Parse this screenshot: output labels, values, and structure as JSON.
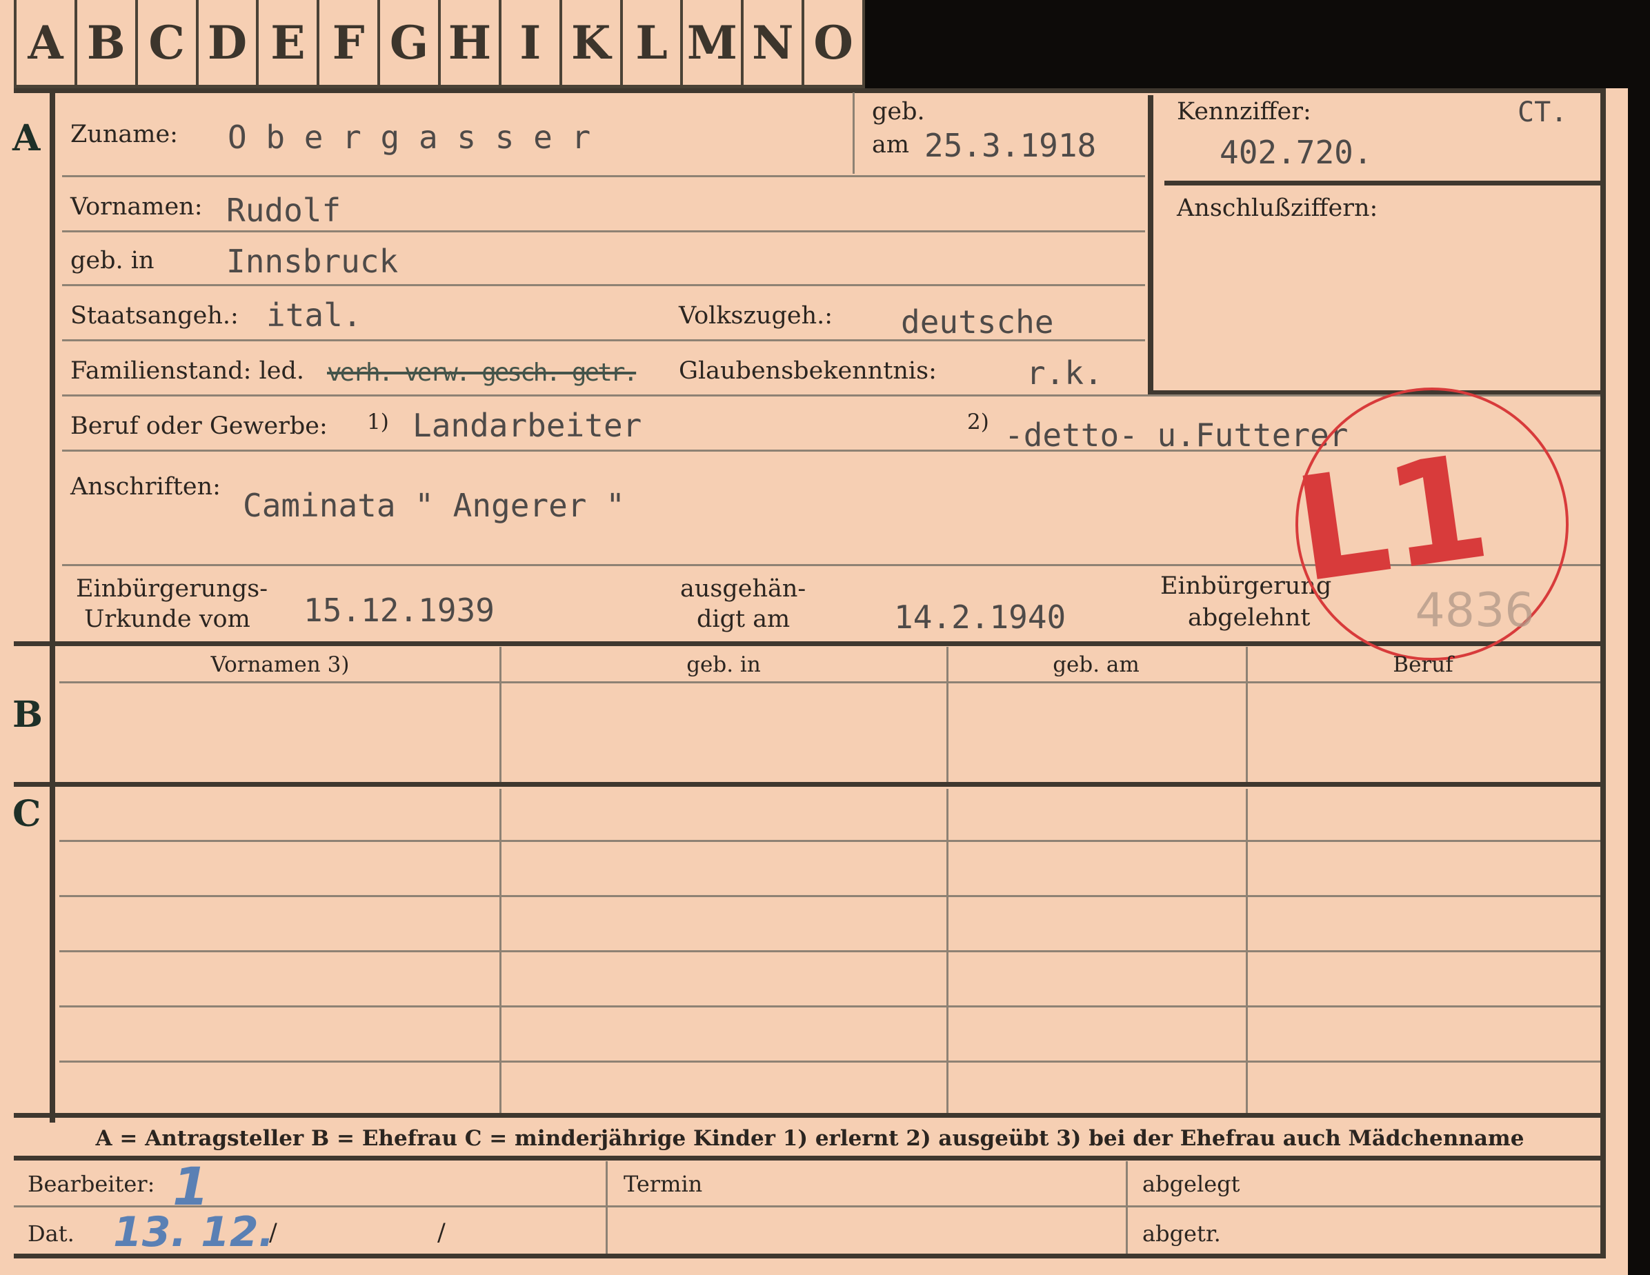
{
  "tabs": [
    "A",
    "B",
    "C",
    "D",
    "E",
    "F",
    "G",
    "H",
    "I",
    "K",
    "L",
    "M",
    "N",
    "O"
  ],
  "sections": {
    "a": "A",
    "b": "B",
    "c": "C"
  },
  "labels": {
    "zuname": "Zuname:",
    "geb_top": "geb.",
    "geb_am": "am",
    "kennziffer": "Kennziffer:",
    "anschluss": "Anschlußziffern:",
    "vornamen": "Vornamen:",
    "geb_in": "geb. in",
    "staatsangeh": "Staatsangeh.:",
    "volkszugeh": "Volkszugeh.:",
    "familienstand": "Familienstand: led.",
    "familien_strike": "verh. verw. gesch. getr.",
    "glaubens": "Glaubensbekenntnis:",
    "beruf": "Beruf oder Gewerbe:",
    "beruf_note1": "1)",
    "beruf_note2": "2)",
    "anschriften": "Anschriften:",
    "einb_1": "Einbürgerungs-",
    "einb_2": "Urkunde vom",
    "ausg_1": "ausgehän-",
    "ausg_2": "digt am",
    "abgel_1": "Einbürgerung",
    "abgel_2": "abgelehnt"
  },
  "values": {
    "zuname": "O b e r g a s s e r",
    "geb_am": "25.3.1918",
    "kennziffer_suffix": "CT.",
    "kennziffer": "402.720.",
    "vornamen": "Rudolf",
    "geb_in": "Innsbruck",
    "staatsangeh": "ital.",
    "volkszugeh": "deutsche",
    "glaubens": "r.k.",
    "beruf1": "Landarbeiter",
    "beruf2": "-detto- u.Futterer",
    "anschriften": "Caminata \" Angerer \"",
    "einb_vom": "15.12.1939",
    "ausg_am": "14.2.1940"
  },
  "stamp": {
    "code": "L1",
    "number": "4836",
    "color": "#d83b3b"
  },
  "table_b_headers": [
    "Vornamen 3)",
    "geb. in",
    "geb. am",
    "Beruf"
  ],
  "legend": "A = Antragsteller   B = Ehefrau   C = minderjährige Kinder   1) erlernt   2) ausgeübt   3) bei der Ehefrau auch Mädchenname",
  "bottom": {
    "bearbeiter": "Bearbeiter:",
    "bearbeiter_value": "1",
    "termin": "Termin",
    "abgelegt": "abgelegt",
    "dat": "Dat.",
    "dat_value": "13. 12.",
    "slash1": "/",
    "slash2": "/",
    "abgetr": "abgetr."
  },
  "colors": {
    "card": "#f6cfb3",
    "ink": "#2b2520",
    "typewriter": "#4e4a48",
    "stamp": "#d83b3b",
    "pencil": "#5a80b4"
  }
}
